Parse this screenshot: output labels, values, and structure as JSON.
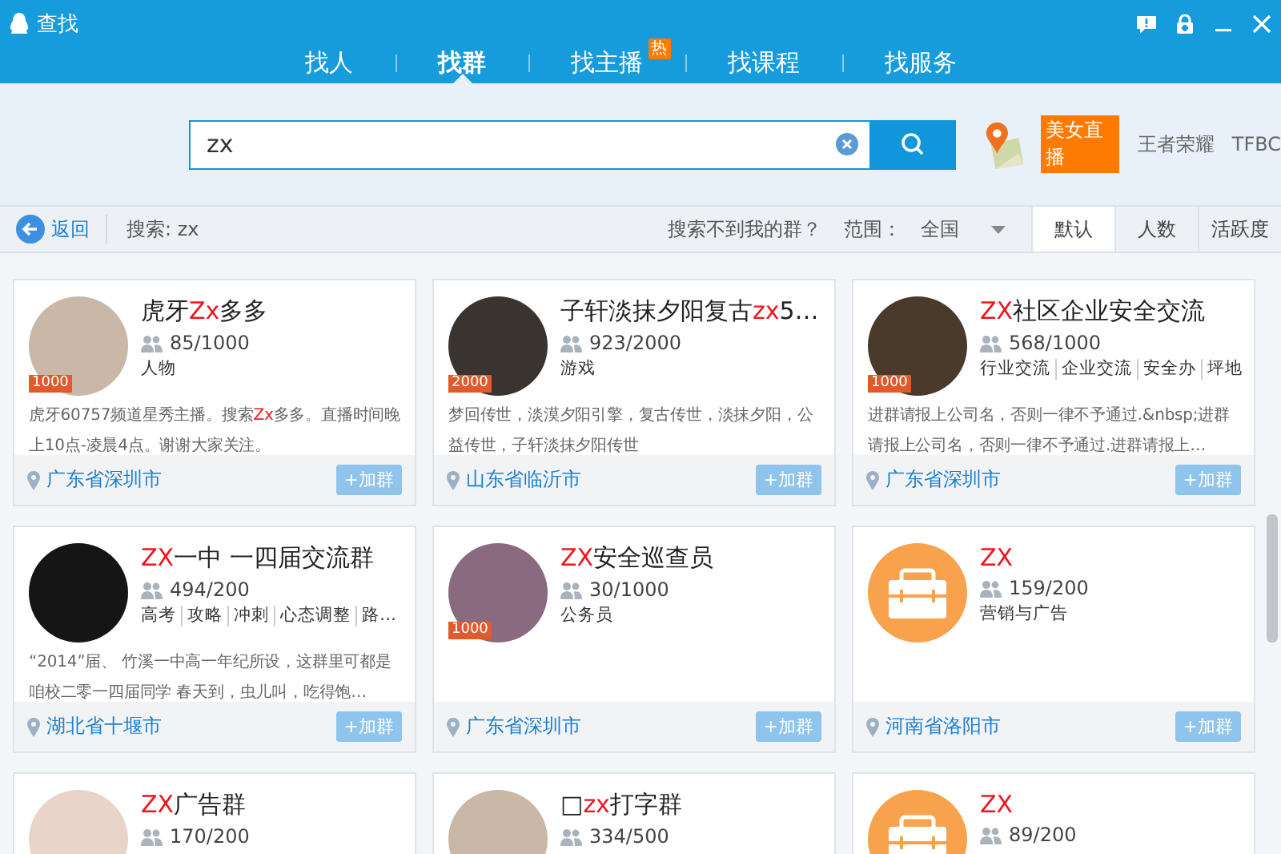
{
  "window": {
    "title": "查找"
  },
  "tabs": [
    {
      "label": "找人",
      "selected": false
    },
    {
      "label": "找群",
      "selected": true
    },
    {
      "label": "找主播",
      "selected": false,
      "badge": "热"
    },
    {
      "label": "找课程",
      "selected": false
    },
    {
      "label": "找服务",
      "selected": false
    }
  ],
  "search": {
    "value": "zx"
  },
  "hot_links": [
    {
      "text": "美女直播",
      "kind": "badge"
    },
    {
      "text": "王者荣耀",
      "kind": "link"
    },
    {
      "text": "TFBC",
      "kind": "link"
    }
  ],
  "toolbar": {
    "back": "返回",
    "query": "搜索: zx",
    "help_link": "搜索不到我的群？",
    "range_label": "范围：",
    "range_value": "全国",
    "sort_tabs": [
      {
        "label": "默认",
        "selected": true
      },
      {
        "label": "人数",
        "selected": false
      },
      {
        "label": "活跃度",
        "selected": false
      }
    ]
  },
  "cards": [
    {
      "kind": "photo",
      "level_badge": "1000",
      "name": [
        {
          "text": "虎牙",
          "match": false
        },
        {
          "text": "Zx",
          "match": true
        },
        {
          "text": "多多",
          "match": false
        }
      ],
      "members": "85/1000",
      "tags": [
        "人物"
      ],
      "description": [
        {
          "text": "虎牙60757频道星秀主播。搜索",
          "match": false
        },
        {
          "text": "Zx",
          "match": true
        },
        {
          "text": "多多。直播时间晚上10点-凌晨4点。谢谢大家关注。",
          "match": false
        }
      ],
      "location": "广东省深圳市",
      "join": "+加群"
    },
    {
      "kind": "photo",
      "level_badge": "2000",
      "name": [
        {
          "text": "子轩淡抹夕阳复古",
          "match": false
        },
        {
          "text": "zx",
          "match": true
        },
        {
          "text": "5…",
          "match": false
        }
      ],
      "members": "923/2000",
      "tags": [
        "游戏"
      ],
      "description": [
        {
          "text": "梦回传世，淡漠夕阳引擎，复古传世，淡抹夕阳，公益传世，子轩淡抹夕阳传世",
          "match": false
        }
      ],
      "location": "山东省临沂市",
      "join": "+加群"
    },
    {
      "kind": "photo",
      "level_badge": "1000",
      "name": [
        {
          "text": "ZX",
          "match": true
        },
        {
          "text": "社区企业安全交流",
          "match": false
        }
      ],
      "members": "568/1000",
      "tags": [
        "行业交流",
        "企业交流",
        "安全办",
        "坪地"
      ],
      "description": [
        {
          "text": "进群请报上公司名，否则一律不予通过.&nbsp;进群请报上公司名，否则一律不予通过.进群请报上…",
          "match": false
        }
      ],
      "location": "广东省深圳市",
      "join": "+加群"
    },
    {
      "kind": "photo",
      "name": [
        {
          "text": "ZX",
          "match": true
        },
        {
          "text": "一中 一四届交流群",
          "match": false
        }
      ],
      "members": "494/200",
      "tags": [
        "高考",
        "攻略",
        "冲刺",
        "心态调整",
        "路…"
      ],
      "description": [
        {
          "text": "“2014”届、 竹溪一中高一年纪所设，这群里可都是咱校二零一四届同学 春天到，虫儿叫，吃得饱…",
          "match": false
        }
      ],
      "location": "湖北省十堰市",
      "join": "+加群"
    },
    {
      "kind": "photo",
      "level_badge": "1000",
      "name": [
        {
          "text": "ZX",
          "match": true
        },
        {
          "text": "安全巡查员",
          "match": false
        }
      ],
      "members": "30/1000",
      "tags": [
        "公务员"
      ],
      "location": "广东省深圳市",
      "join": "+加群"
    },
    {
      "kind": "briefcase",
      "name": [
        {
          "text": "ZX",
          "match": true
        }
      ],
      "members": "159/200",
      "tags": [
        "营销与广告"
      ],
      "location": "河南省洛阳市",
      "join": "+加群"
    },
    {
      "kind": "photo",
      "name": [
        {
          "text": "ZX",
          "match": true
        },
        {
          "text": "广告群",
          "match": false
        }
      ],
      "members": "170/200"
    },
    {
      "kind": "photo",
      "name": [
        {
          "text": "□",
          "match": false
        },
        {
          "text": "zx",
          "match": true
        },
        {
          "text": "打字群",
          "match": false
        }
      ],
      "members": "334/500"
    },
    {
      "kind": "briefcase",
      "name": [
        {
          "text": "ZX",
          "match": true
        }
      ],
      "members": "89/200"
    }
  ]
}
